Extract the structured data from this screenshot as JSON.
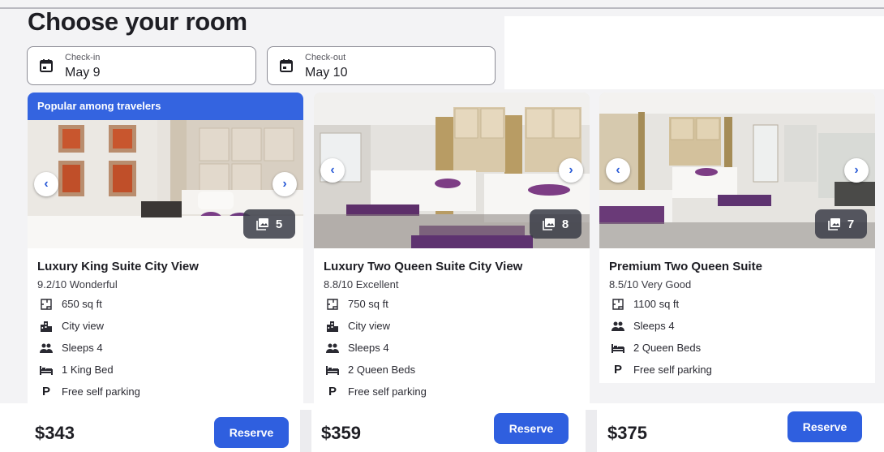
{
  "page": {
    "title": "Choose your room"
  },
  "dates": {
    "checkin": {
      "label": "Check-in",
      "value": "May 9"
    },
    "checkout": {
      "label": "Check-out",
      "value": "May 10"
    }
  },
  "rooms": [
    {
      "badge": "Popular among travelers",
      "name": "Luxury King Suite City View",
      "rating": "9.2/10 Wonderful",
      "photo_count": "5",
      "amenities": [
        {
          "icon": "floor-plan-icon",
          "text": "650 sq ft"
        },
        {
          "icon": "city-icon",
          "text": "City view"
        },
        {
          "icon": "people-icon",
          "text": "Sleeps 4"
        },
        {
          "icon": "bed-icon",
          "text": "1 King Bed"
        },
        {
          "icon": "parking-icon",
          "text": "Free self parking"
        }
      ],
      "price": "$343",
      "reserve_label": "Reserve"
    },
    {
      "name": "Luxury Two Queen Suite City View",
      "rating": "8.8/10 Excellent",
      "photo_count": "8",
      "amenities": [
        {
          "icon": "floor-plan-icon",
          "text": "750 sq ft"
        },
        {
          "icon": "city-icon",
          "text": "City view"
        },
        {
          "icon": "people-icon",
          "text": "Sleeps 4"
        },
        {
          "icon": "bed-icon",
          "text": "2 Queen Beds"
        },
        {
          "icon": "parking-icon",
          "text": "Free self parking"
        }
      ],
      "price": "$359",
      "reserve_label": "Reserve"
    },
    {
      "name": "Premium Two Queen Suite",
      "rating": "8.5/10 Very Good",
      "photo_count": "7",
      "amenities": [
        {
          "icon": "floor-plan-icon",
          "text": "1100 sq ft"
        },
        {
          "icon": "people-icon",
          "text": "Sleeps 4"
        },
        {
          "icon": "bed-icon",
          "text": "2 Queen Beds"
        },
        {
          "icon": "parking-icon",
          "text": "Free self parking"
        }
      ],
      "price": "$375",
      "reserve_label": "Reserve"
    }
  ],
  "parking_letter": "P",
  "colors": {
    "accent": "#2f5fdf",
    "badge": "#3464e0"
  }
}
